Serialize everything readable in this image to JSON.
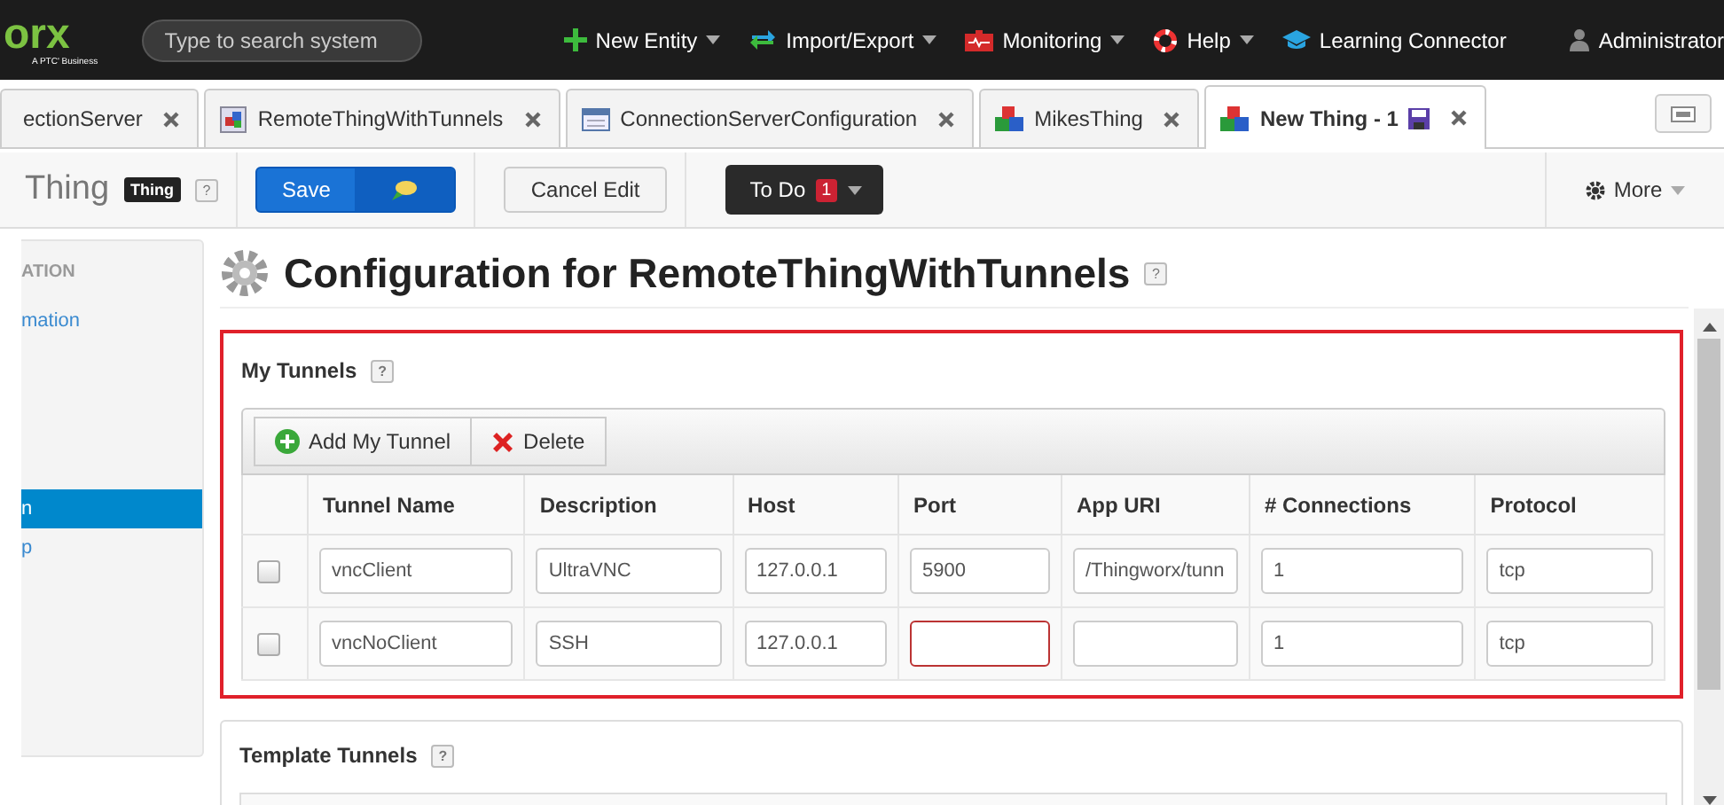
{
  "topbar": {
    "logo": "orx",
    "logo_sub": "A PTC' Business",
    "search": {
      "placeholder": "Type to search system"
    },
    "menus": [
      {
        "label": "New Entity",
        "kind": "plus",
        "dropdown": true
      },
      {
        "label": "Import/Export",
        "kind": "arrows",
        "dropdown": true
      },
      {
        "label": "Monitoring",
        "kind": "monitor",
        "dropdown": true
      },
      {
        "label": "Help",
        "kind": "lifebuoy",
        "dropdown": true
      },
      {
        "label": "Learning Connector",
        "kind": "cap",
        "dropdown": false
      },
      {
        "label": "Administrator",
        "kind": "user",
        "dropdown": false
      }
    ]
  },
  "tabs": [
    {
      "label": "ectionServer",
      "kind": "none",
      "selected": false,
      "unsaved": false
    },
    {
      "label": "RemoteThingWithTunnels",
      "kind": "thing",
      "selected": false,
      "unsaved": false
    },
    {
      "label": "ConnectionServerConfiguration",
      "kind": "config",
      "selected": false,
      "unsaved": false
    },
    {
      "label": "MikesThing",
      "kind": "blocks",
      "selected": false,
      "unsaved": false
    },
    {
      "label": "New Thing - 1",
      "kind": "blocks",
      "selected": true,
      "unsaved": true
    }
  ],
  "toolbar": {
    "entity": "Thing",
    "badge": "Thing",
    "help": "?",
    "save": "Save",
    "cancel": "Cancel Edit",
    "todo": "To Do",
    "todo_count": "1",
    "more": "More"
  },
  "sidebar": {
    "header": "ATION",
    "items": [
      {
        "label": "mation",
        "selected": false
      },
      {
        "label": "n",
        "selected": true
      },
      {
        "label": "p",
        "selected": false
      }
    ]
  },
  "title": "Configuration for RemoteThingWithTunnels",
  "title_help": "?",
  "my_tunnels": {
    "title": "My Tunnels",
    "help": "?",
    "buttons": [
      {
        "label": "Add My Tunnel",
        "kind": "add"
      },
      {
        "label": "Delete",
        "kind": "delete"
      }
    ],
    "columns": [
      "Tunnel Name",
      "Description",
      "Host",
      "Port",
      "App URI",
      "# Connections",
      "Protocol"
    ],
    "rows": [
      {
        "checked": false,
        "cells": [
          {
            "value": "vncClient",
            "invalid": false
          },
          {
            "value": "UltraVNC",
            "invalid": false
          },
          {
            "value": "127.0.0.1",
            "invalid": false
          },
          {
            "value": "5900",
            "invalid": false
          },
          {
            "value": "/Thingworx/tunn",
            "invalid": false
          },
          {
            "value": "1",
            "invalid": false
          },
          {
            "value": "tcp",
            "invalid": false
          }
        ]
      },
      {
        "checked": false,
        "cells": [
          {
            "value": "vncNoClient",
            "invalid": false
          },
          {
            "value": "SSH",
            "invalid": false
          },
          {
            "value": "127.0.0.1",
            "invalid": false
          },
          {
            "invalid": true
          },
          {
            "invalid": false
          },
          {
            "value": "1",
            "invalid": false
          },
          {
            "value": "tcp",
            "invalid": false
          }
        ]
      }
    ]
  },
  "template_tunnels": {
    "title": "Template Tunnels",
    "help": "?"
  }
}
